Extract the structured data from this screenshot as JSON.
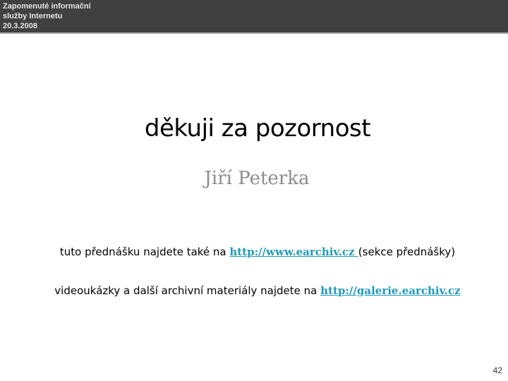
{
  "header": {
    "line1": "Zapomenuté informační",
    "line2": "služby Internetu",
    "line3": "20.3.2008"
  },
  "slide": {
    "title": "děkuji za pozornost",
    "subtitle": "Jiří Peterka",
    "line1": {
      "before": "tuto přednášku najdete také na ",
      "link": "http://www.earchiv.cz ",
      "after": "(sekce  přednášky)"
    },
    "line2": {
      "before": "videoukázky a další  archivní materiály najdete na ",
      "link": "http://galerie.earchiv.cz"
    },
    "page_number": "42"
  },
  "colors": {
    "header_bg": "#404040",
    "header_text": "#e6e6e6",
    "link": "#1f9bb8",
    "subtitle": "#8c8c8c"
  }
}
